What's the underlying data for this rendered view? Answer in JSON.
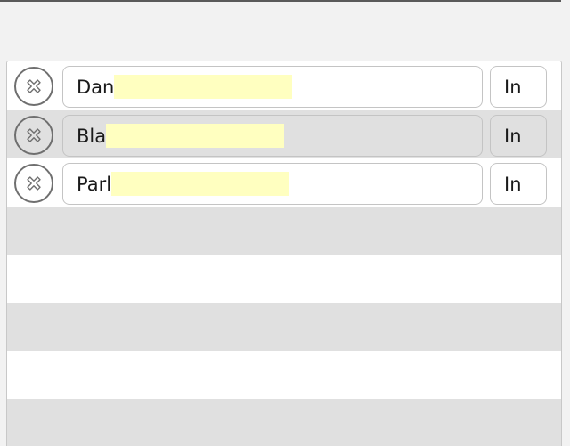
{
  "rows": [
    {
      "name_visible": "Dan",
      "name_redacted": true,
      "status": "In"
    },
    {
      "name_visible": "Bla",
      "name_redacted": true,
      "status": "In"
    },
    {
      "name_visible": "Parl",
      "name_redacted": true,
      "status": "In"
    }
  ],
  "icons": {
    "remove": "remove-circle-x-icon"
  },
  "colors": {
    "page_background": "#f2f2f2",
    "row_alternate": "#e0e0e0",
    "redaction_highlight": "#ffffc0"
  }
}
